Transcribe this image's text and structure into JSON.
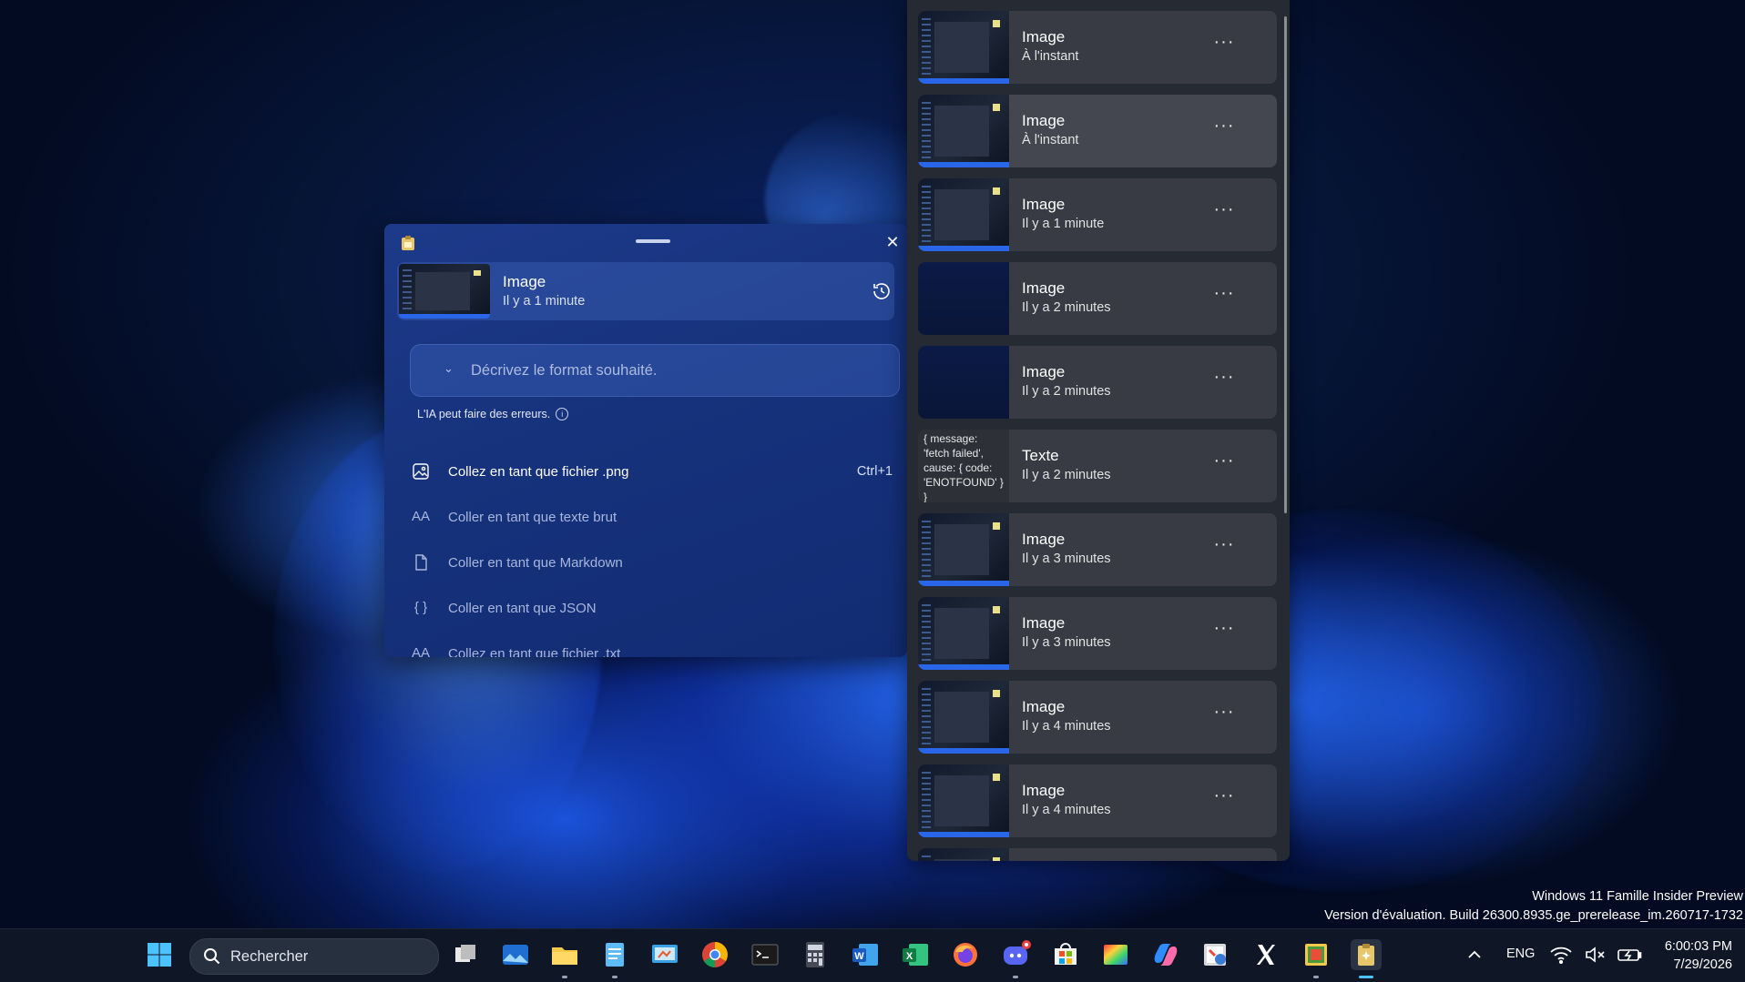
{
  "watermark": {
    "line1": "Windows 11 Famille Insider Preview",
    "line2": "Version d'évaluation. Build 26300.8935.ge_prerelease_im.260717-1732"
  },
  "paste_window": {
    "current_clip": {
      "title": "Image",
      "subtitle": "Il y a 1 minute"
    },
    "close_glyph": "✕",
    "input_placeholder": "Décrivez le format souhaité.",
    "ai_note": "L'IA peut faire des erreurs.",
    "ai_note_info_glyph": "i",
    "options": [
      {
        "label": "Collez en tant que fichier .png",
        "shortcut": "Ctrl+1",
        "icon": "image-icon",
        "glyph": ""
      },
      {
        "label": "Coller en tant que texte brut",
        "shortcut": "",
        "icon": "text-size-icon",
        "glyph": "AA"
      },
      {
        "label": "Coller en tant que Markdown",
        "shortcut": "",
        "icon": "document-icon",
        "glyph": ""
      },
      {
        "label": "Coller en tant que JSON",
        "shortcut": "",
        "icon": "braces-icon",
        "glyph": "{ }"
      },
      {
        "label": "Collez en tant que fichier .txt",
        "shortcut": "",
        "icon": "text-file-icon",
        "glyph": "AA"
      }
    ]
  },
  "history": {
    "more_glyph": "···",
    "items": [
      {
        "title": "Image",
        "subtitle": "À l'instant",
        "kind": "screenshot"
      },
      {
        "title": "Image",
        "subtitle": "À l'instant",
        "kind": "screenshot"
      },
      {
        "title": "Image",
        "subtitle": "Il y a 1 minute",
        "kind": "screenshot"
      },
      {
        "title": "Image",
        "subtitle": "Il y a 2 minutes",
        "kind": "plain"
      },
      {
        "title": "Image",
        "subtitle": "Il y a 2 minutes",
        "kind": "plain"
      },
      {
        "title": "Texte",
        "subtitle": "Il y a 2 minutes",
        "kind": "text",
        "preview": "{ message: 'fetch failed', cause: { code: 'ENOTFOUND' } }"
      },
      {
        "title": "Image",
        "subtitle": "Il y a 3 minutes",
        "kind": "screenshot"
      },
      {
        "title": "Image",
        "subtitle": "Il y a 3 minutes",
        "kind": "screenshot"
      },
      {
        "title": "Image",
        "subtitle": "Il y a 4 minutes",
        "kind": "screenshot"
      },
      {
        "title": "Image",
        "subtitle": "Il y a 4 minutes",
        "kind": "screenshot"
      }
    ]
  },
  "taskbar": {
    "search_label": "Rechercher",
    "language": "ENG",
    "time": "6:00:03 PM",
    "date": "7/29/2026",
    "apps": [
      "windows-start",
      "task-view",
      "photos",
      "file-explorer",
      "notepad",
      "control-panel",
      "chrome",
      "terminal",
      "calculator",
      "word",
      "excel",
      "firefox",
      "discord",
      "microsoft-store",
      "color-app",
      "copilot",
      "paint",
      "x-app",
      "app-installer",
      "advanced-paste"
    ]
  },
  "colors": {
    "paste_window_bg": "#16327c",
    "history_bg": "#262a33",
    "history_item_bg": "#383b43",
    "taskbar_bg": "#0f1726",
    "accent": "#2a66e8"
  }
}
